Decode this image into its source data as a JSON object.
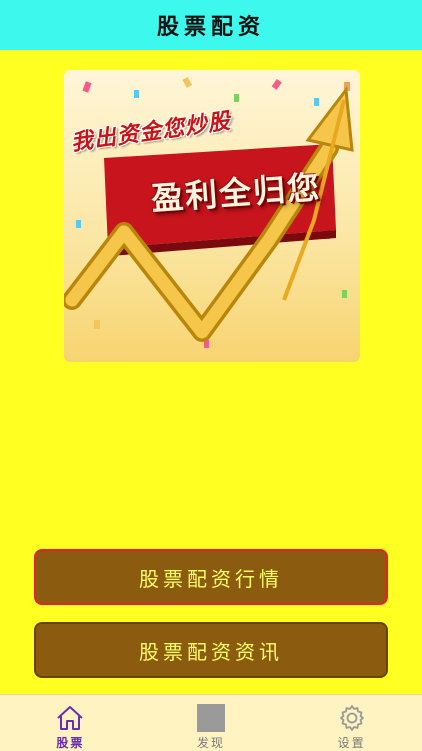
{
  "header": {
    "title": "股票配资"
  },
  "banner": {
    "line1": "我出资金您炒股",
    "line2": "盈利全归您"
  },
  "menu": {
    "quotes_label": "股票配资行情",
    "news_label": "股票配资资讯"
  },
  "tabbar": {
    "items": [
      {
        "label": "股票",
        "icon": "home-icon",
        "active": true
      },
      {
        "label": "发现",
        "icon": "discover-icon",
        "active": false
      },
      {
        "label": "设置",
        "icon": "gear-icon",
        "active": false
      }
    ]
  },
  "colors": {
    "header_bg": "#3DF8EC",
    "page_bg": "#FFFF22",
    "button_bg": "#8B5B10",
    "button_text": "#FFFF66",
    "active_tab": "#6A2FB0"
  }
}
